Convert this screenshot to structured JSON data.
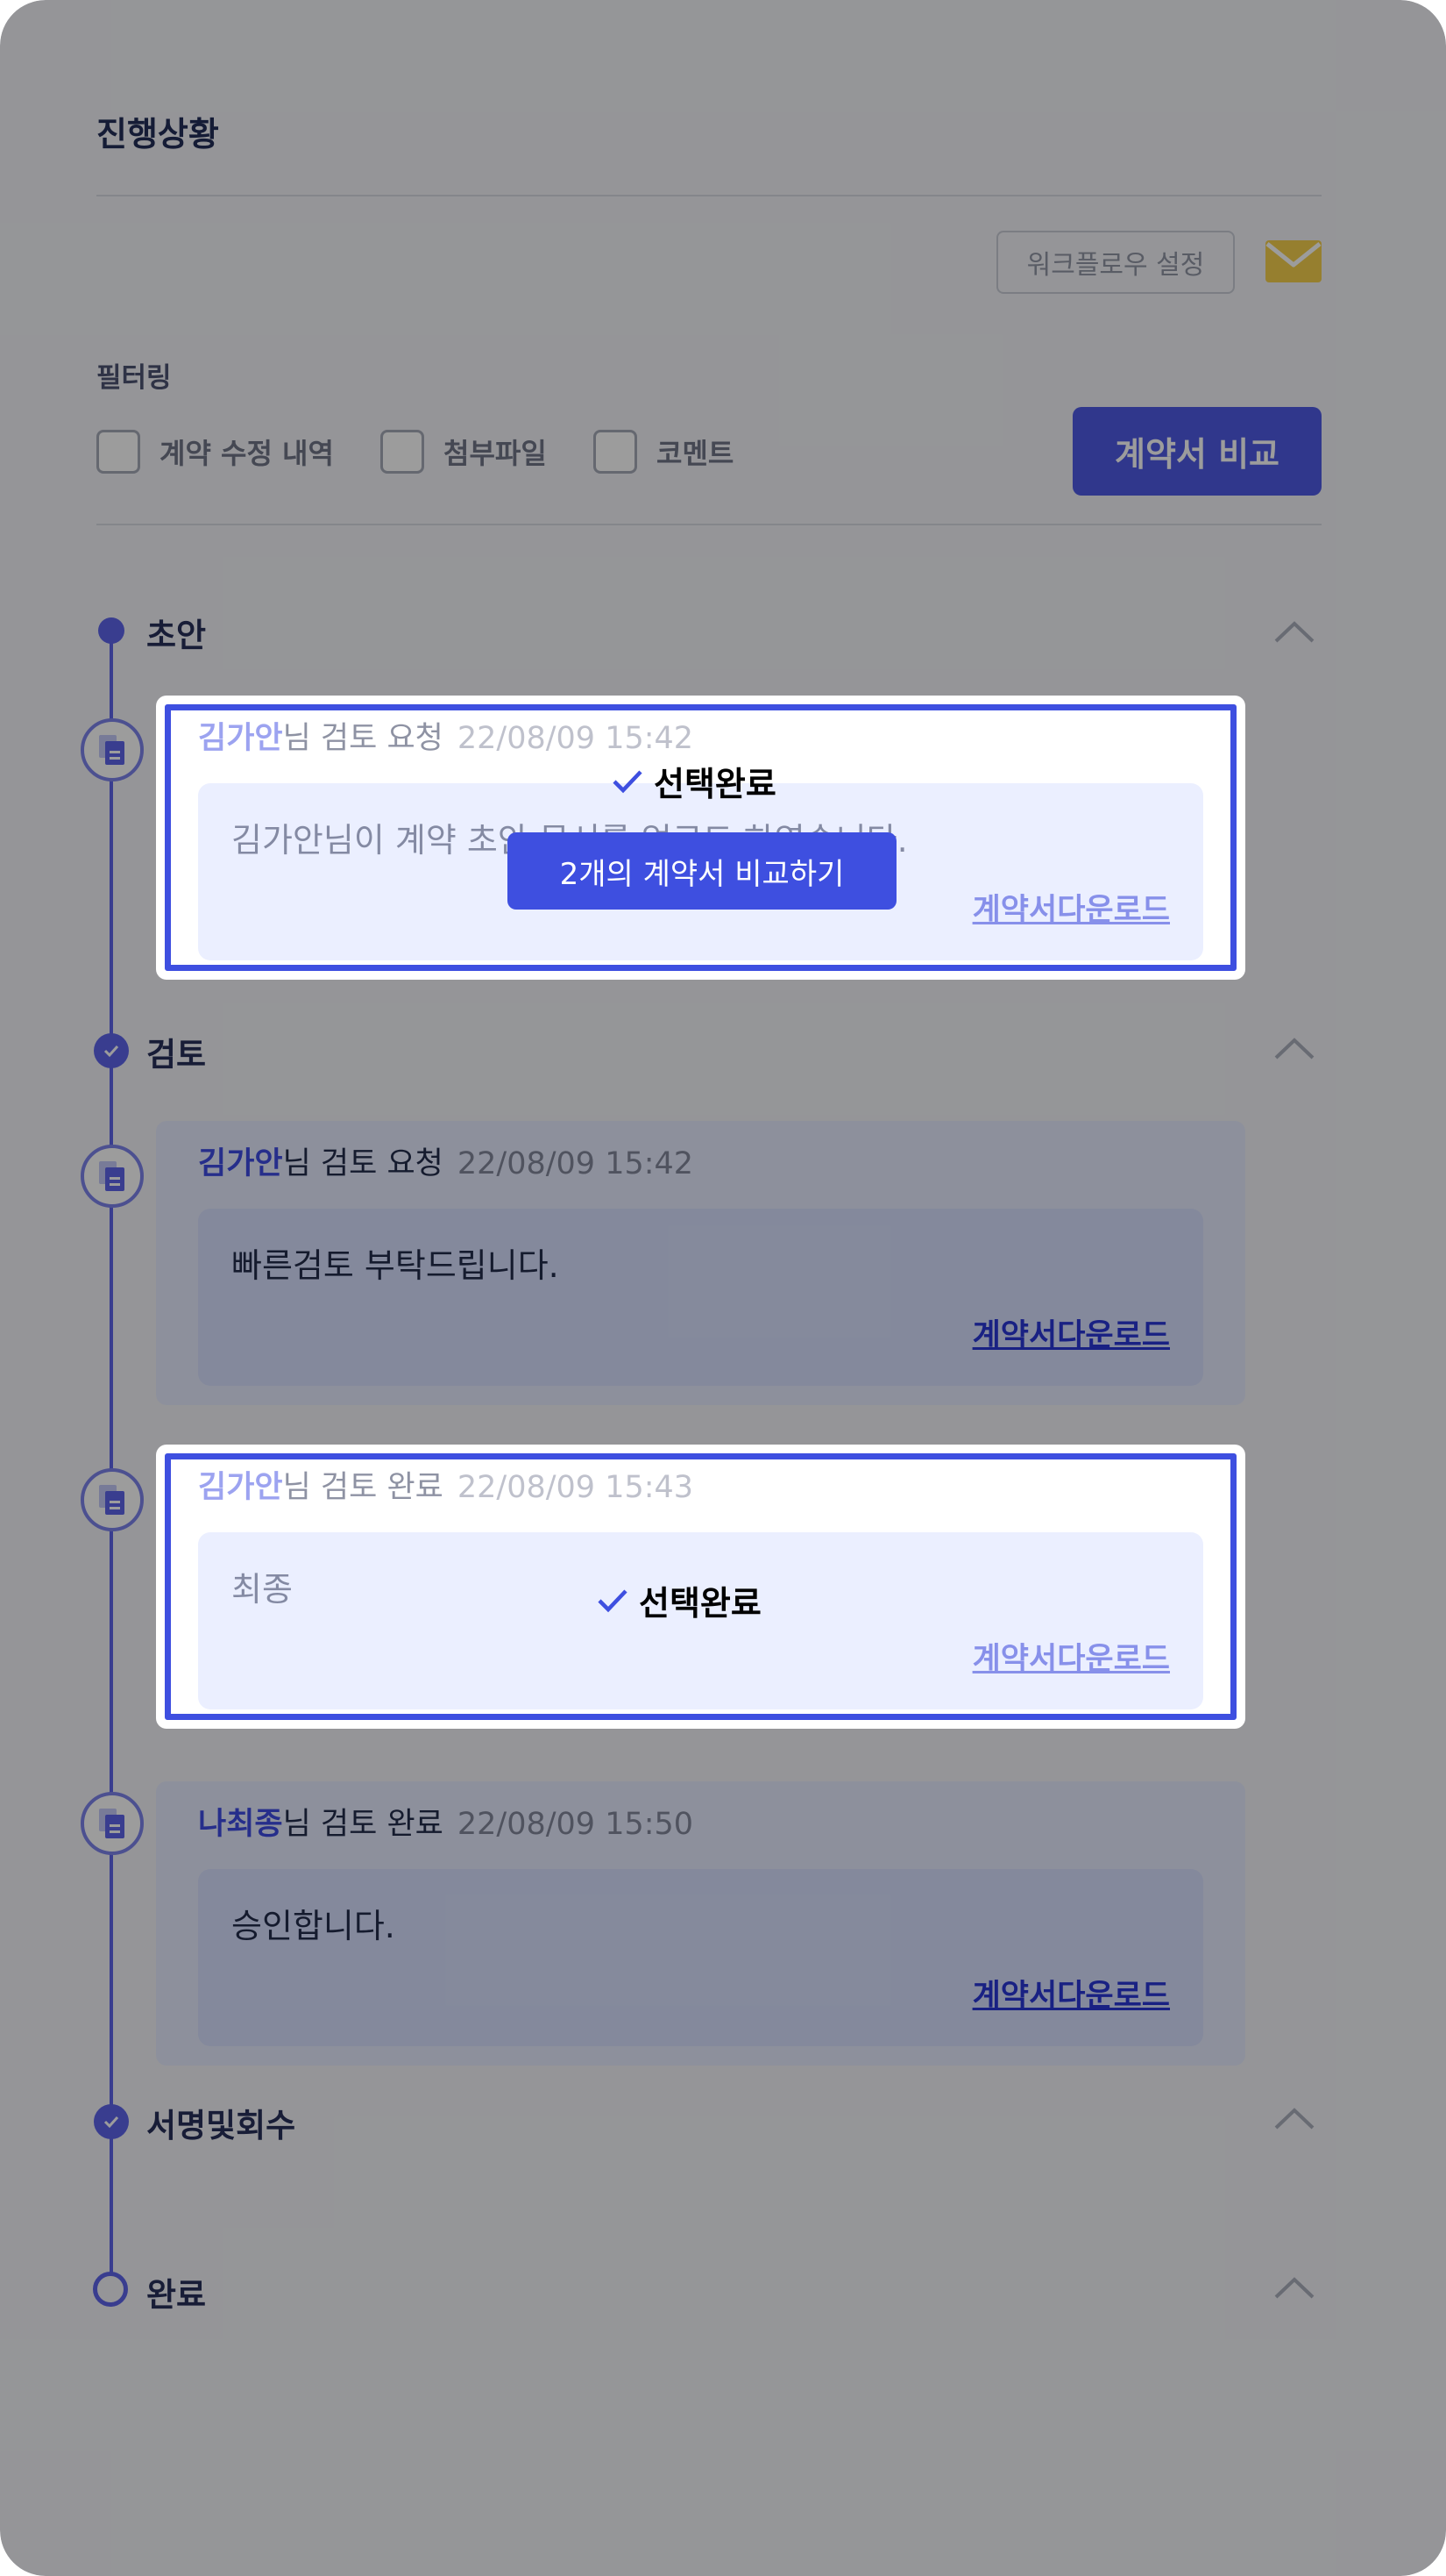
{
  "header": {
    "title": "진행상황"
  },
  "toolbar": {
    "workflow_label": "워크플로우 설정",
    "mail_icon": "mail-icon"
  },
  "filter": {
    "title": "필터링",
    "options": [
      {
        "label": "계약 수정 내역",
        "checked": false
      },
      {
        "label": "첨부파일",
        "checked": false
      },
      {
        "label": "코멘트",
        "checked": false
      }
    ],
    "compare_label": "계약서 비교"
  },
  "stages": {
    "draft": "초안",
    "review": "검토",
    "sign": "서명및회수",
    "done": "완료"
  },
  "cards": [
    {
      "who": "김가안",
      "suffix": "님 검토 요청",
      "date": "22/08/09 15:42",
      "message": "김가안님이 계약 초안 문서를 업로드 하였습니다.",
      "download": "계약서다운로드",
      "selected": true
    },
    {
      "who": "김가안",
      "suffix": "님 검토 요청",
      "date": "22/08/09 15:42",
      "message": "빠른검토 부탁드립니다.",
      "download": "계약서다운로드",
      "selected": false
    },
    {
      "who": "김가안",
      "suffix": "님 검토 완료",
      "date": "22/08/09 15:43",
      "message": "최종",
      "download": "계약서다운로드",
      "selected": true
    },
    {
      "who": "나최종",
      "suffix": "님 검토 완료",
      "date": "22/08/09 15:50",
      "message": "승인합니다.",
      "download": "계약서다운로드",
      "selected": false
    }
  ],
  "selection": {
    "done_label": "선택완료",
    "compare_button": "2개의 계약서 비교하기"
  },
  "colors": {
    "accent": "#3e4fe0",
    "card": "#e6ecff",
    "card_inner": "#d8e0ff",
    "overlay": "rgba(8,8,8,0.4)"
  }
}
